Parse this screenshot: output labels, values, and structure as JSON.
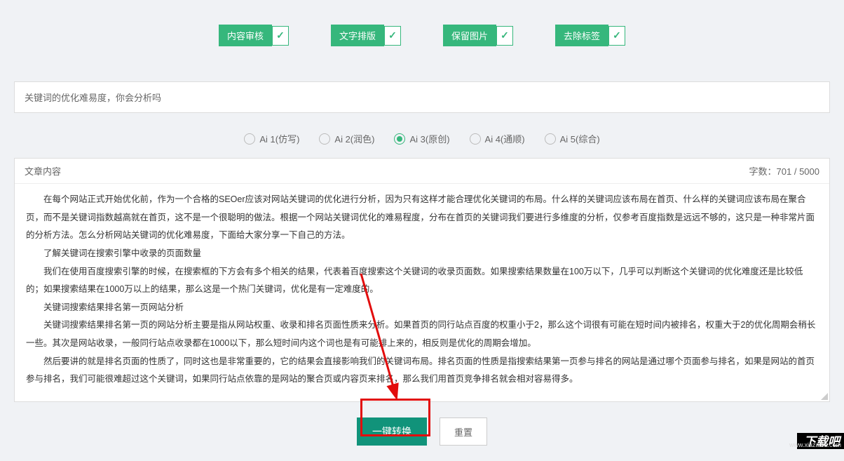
{
  "options": [
    {
      "label": "内容审核"
    },
    {
      "label": "文字排版"
    },
    {
      "label": "保留图片"
    },
    {
      "label": "去除标签"
    }
  ],
  "titleInput": "关键词的优化难易度，你会分析吗",
  "aiModes": [
    {
      "label": "Ai 1(仿写)",
      "selected": false
    },
    {
      "label": "Ai 2(润色)",
      "selected": false
    },
    {
      "label": "Ai 3(原创)",
      "selected": true
    },
    {
      "label": "Ai 4(通顺)",
      "selected": false
    },
    {
      "label": "Ai 5(综合)",
      "selected": false
    }
  ],
  "contentHeader": {
    "label": "文章内容",
    "counter": "字数：701 / 5000"
  },
  "paragraphs": [
    "在每个网站正式开始优化前，作为一个合格的SEOer应该对网站关键词的优化进行分析，因为只有这样才能合理优化关键词的布局。什么样的关键词应该布局在首页、什么样的关键词应该布局在聚合页，而不是关键词指数越高就在首页，这不是一个很聪明的做法。根据一个网站关键词优化的难易程度，分布在首页的关键词我们要进行多维度的分析，仅参考百度指数是远远不够的，这只是一种非常片面的分析方法。怎么分析网站关键词的优化难易度，下面给大家分享一下自己的方法。",
    "了解关键词在搜索引擎中收录的页面数量",
    "我们在使用百度搜索引擎的时候，在搜索框的下方会有多个相关的结果，代表着百度搜索这个关键词的收录页面数。如果搜索结果数量在100万以下，几乎可以判断这个关键词的优化难度还是比较低的；如果搜索结果在1000万以上的结果，那么这是一个热门关键词，优化是有一定难度的。",
    "关键词搜索结果排名第一页网站分析",
    "关键词搜索结果排名第一页的网站分析主要是指从网站权重、收录和排名页面性质来分析。如果首页的同行站点百度的权重小于2，那么这个词很有可能在短时间内被排名，权重大于2的优化周期会稍长一些。其次是网站收录，一般同行站点收录都在1000以下，那么短时间内这个词也是有可能排上来的，相反则是优化的周期会增加。",
    "然后要讲的就是排名页面的性质了，同时这也是非常重要的，它的结果会直接影响我们的关键词布局。排名页面的性质是指搜索结果第一页参与排名的网站是通过哪个页面参与排名，如果是网站的首页参与排名，我们可能很难超过这个关键词，如果同行站点依靠的是网站的聚合页或内容页来排名，那么我们用首页竞争排名就会相对容易得多。"
  ],
  "buttons": {
    "primary": "一键转换",
    "secondary": "重置"
  },
  "watermark": {
    "main": "下载吧",
    "url": "www.xiazaiba.com"
  }
}
